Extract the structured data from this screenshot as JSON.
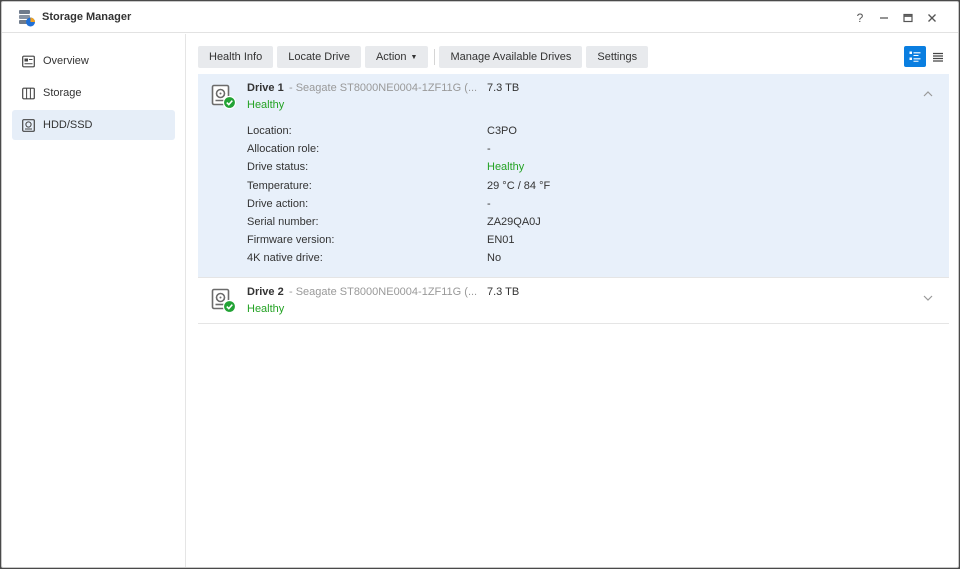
{
  "window": {
    "title": "Storage Manager"
  },
  "sidebar": {
    "items": [
      {
        "label": "Overview",
        "icon": "overview-icon",
        "active": false
      },
      {
        "label": "Storage",
        "icon": "storage-icon",
        "active": false
      },
      {
        "label": "HDD/SSD",
        "icon": "hdd-icon",
        "active": true
      }
    ]
  },
  "toolbar": {
    "health_info": "Health Info",
    "locate_drive": "Locate Drive",
    "action": "Action",
    "manage_drives": "Manage Available Drives",
    "settings": "Settings"
  },
  "drives": [
    {
      "name": "Drive 1",
      "model": "- Seagate ST8000NE0004-1ZF11G (...",
      "capacity": "7.3 TB",
      "health": "Healthy",
      "expanded": true,
      "details": [
        {
          "label": "Location:",
          "value": "C3PO"
        },
        {
          "label": "Allocation role:",
          "value": "-"
        },
        {
          "label": "Drive status:",
          "value": "Healthy"
        },
        {
          "label": "Temperature:",
          "value": "29 °C / 84 °F"
        },
        {
          "label": "Drive action:",
          "value": "-"
        },
        {
          "label": "Serial number:",
          "value": "ZA29QA0J"
        },
        {
          "label": "Firmware version:",
          "value": "EN01"
        },
        {
          "label": "4K native drive:",
          "value": "No"
        }
      ]
    },
    {
      "name": "Drive 2",
      "model": "- Seagate ST8000NE0004-1ZF11G (...",
      "capacity": "7.3 TB",
      "health": "Healthy",
      "expanded": false
    }
  ],
  "colors": {
    "accent": "#0a7ee0",
    "healthy": "#23a223",
    "selected_bg": "#e8f0fa"
  }
}
